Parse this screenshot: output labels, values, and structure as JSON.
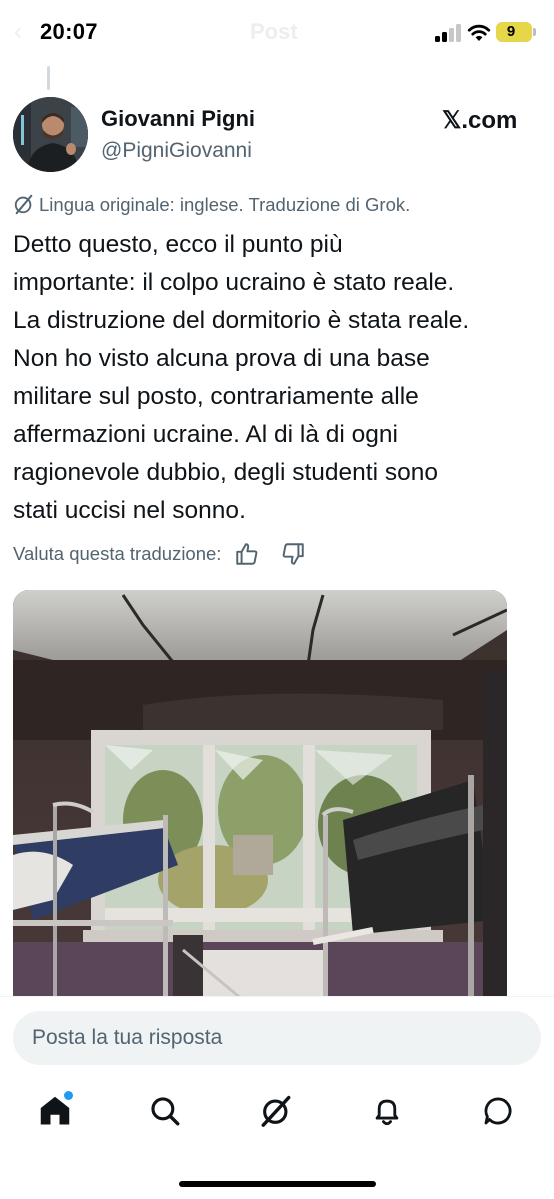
{
  "status_bar": {
    "time": "20:07",
    "ghost_title": "Post",
    "battery": "9"
  },
  "author": {
    "name": "Giovanni Pigni",
    "handle": "@PigniGiovanni"
  },
  "source_logo": "𝕏.com",
  "translation": {
    "notice": "Lingua originale: inglese. Traduzione di Grok.",
    "rate_label": "Valuta questa traduzione:"
  },
  "tweet": {
    "lines": [
      "Detto questo, ecco il punto più",
      "importante: il colpo ucraino è stato reale.",
      "La distruzione del dormitorio è stata reale.",
      "Non ho visto alcuna prova di una base",
      "militare sul posto, contrariamente alle",
      "affermazioni ucraine. Al di là di ogni",
      "ragionevole dubbio, degli studenti sono",
      "stati uccisi nel sonno."
    ]
  },
  "reply": {
    "placeholder": "Posta la tua risposta"
  },
  "tabbar": {
    "items": [
      "home-icon",
      "search-icon",
      "grok-icon",
      "notifications-icon",
      "messages-icon"
    ]
  },
  "colors": {
    "text": "#0f1419",
    "secondary": "#536471",
    "accent": "#1d9bf0",
    "battery": "#e5d64a"
  }
}
